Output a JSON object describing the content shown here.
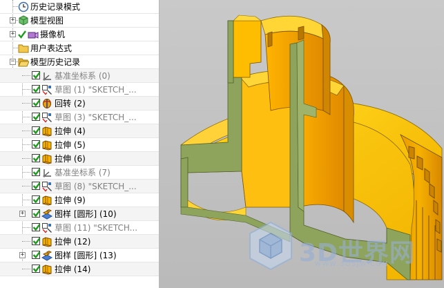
{
  "tree": {
    "top_nodes": [
      {
        "label": "历史记录模式",
        "icon": "clock-icon"
      },
      {
        "label": "模型视图",
        "icon": "model-view-icon"
      },
      {
        "label": "摄像机",
        "icon": "camera-icon"
      },
      {
        "label": "用户表达式",
        "icon": "folder-icon"
      },
      {
        "label": "模型历史记录",
        "icon": "folder-open-icon"
      }
    ],
    "features": [
      {
        "label": "基准坐标系 (0)",
        "icon": "datum-csys-icon",
        "dim": true
      },
      {
        "label": "草图 (1) \"SKETCH_...",
        "icon": "sketch-icon",
        "dim": true
      },
      {
        "label": "回转 (2)",
        "icon": "revolve-icon",
        "dim": false
      },
      {
        "label": "草图 (3) \"SKETCH_...",
        "icon": "sketch-icon",
        "dim": true
      },
      {
        "label": "拉伸 (4)",
        "icon": "extrude-icon",
        "dim": false
      },
      {
        "label": "拉伸 (5)",
        "icon": "extrude-icon",
        "dim": false
      },
      {
        "label": "拉伸 (6)",
        "icon": "extrude-icon",
        "dim": false
      },
      {
        "label": "基准坐标系 (7)",
        "icon": "datum-csys-icon",
        "dim": true
      },
      {
        "label": "草图 (8) \"SKETCH_...",
        "icon": "sketch-icon",
        "dim": true
      },
      {
        "label": "拉伸 (9)",
        "icon": "extrude-icon",
        "dim": false
      },
      {
        "label": "图样 [圆形] (10)",
        "icon": "pattern-icon",
        "dim": false
      },
      {
        "label": "草图 (11) \"SKETCH...",
        "icon": "sketch-icon",
        "dim": true
      },
      {
        "label": "拉伸 (12)",
        "icon": "extrude-icon",
        "dim": false
      },
      {
        "label": "图样 [圆形] (13)",
        "icon": "pattern-icon",
        "dim": false
      },
      {
        "label": "拉伸 (14)",
        "icon": "extrude-icon",
        "dim": false
      }
    ]
  },
  "watermark": {
    "text": "3D世界网",
    "url": "WWW.3DSJW.COM"
  },
  "colors": {
    "part_face": "#ffcc00",
    "part_side": "#f0a000",
    "section_cut": "#8ea35c",
    "viewport_bg": "#c4c4c4",
    "checkbox_green": "#1f9a1f"
  }
}
